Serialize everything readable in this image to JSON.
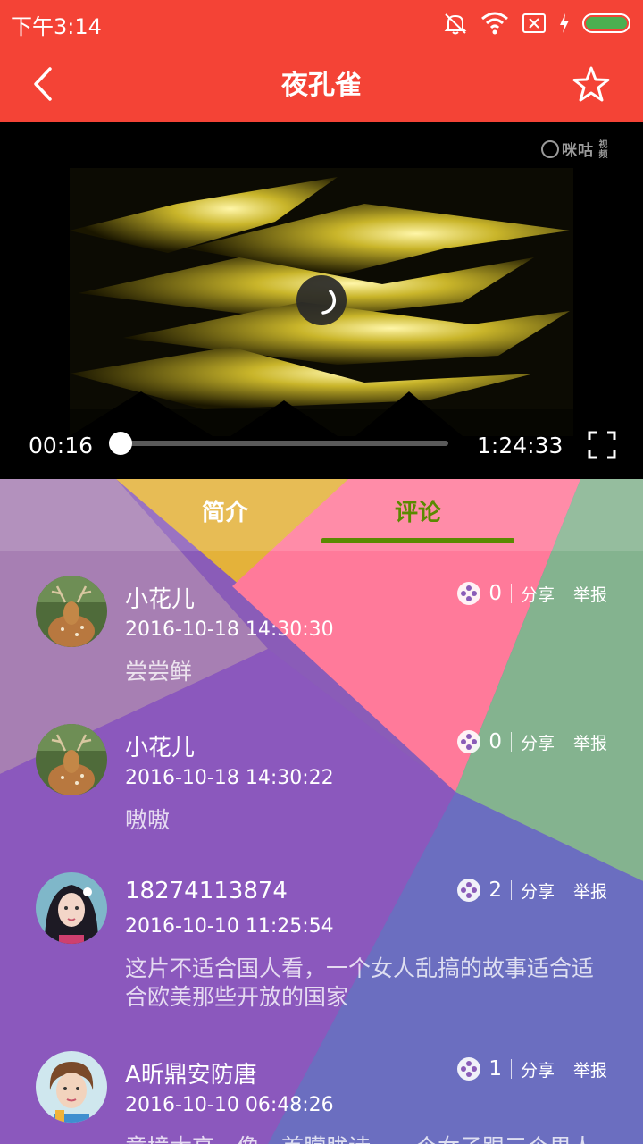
{
  "status_bar": {
    "time": "下午3:14",
    "icons": [
      "mute-icon",
      "wifi-icon",
      "sim-off-icon",
      "charging-icon",
      "battery-icon"
    ]
  },
  "app_bar": {
    "title": "夜孔雀",
    "back_icon": "chevron-left-icon",
    "favorite_icon": "star-outline-icon"
  },
  "player": {
    "watermark": "咪咕",
    "watermark_sub": "视频",
    "current_time": "00:16",
    "total_time": "1:24:33",
    "progress": 0.003
  },
  "tabs": {
    "intro": "简介",
    "comments": "评论",
    "active": "comments"
  },
  "comments": [
    {
      "name": "小花儿",
      "date": "2016-10-18 14:30:30",
      "text": "尝尝鲜",
      "likes": "0",
      "share": "分享",
      "report": "举报",
      "avatar": "deer"
    },
    {
      "name": "小花儿",
      "date": "2016-10-18 14:30:22",
      "text": "嗷嗷",
      "likes": "0",
      "share": "分享",
      "report": "举报",
      "avatar": "deer"
    },
    {
      "name": "18274113874",
      "date": "2016-10-10 11:25:54",
      "text": "这片不适合国人看，一个女人乱搞的故事适合适合欧美那些开放的国家",
      "likes": "2",
      "share": "分享",
      "report": "举报",
      "avatar": "woman"
    },
    {
      "name": "A昕鼎安防唐",
      "date": "2016-10-10 06:48:26",
      "text": "意境太高，像一首朦胧诗，一个女子跟三个男人的故事",
      "likes": "1",
      "share": "分享",
      "report": "举报",
      "avatar": "person"
    }
  ],
  "colors": {
    "primary": "#f44336",
    "tab_active": "#5a8a00"
  }
}
